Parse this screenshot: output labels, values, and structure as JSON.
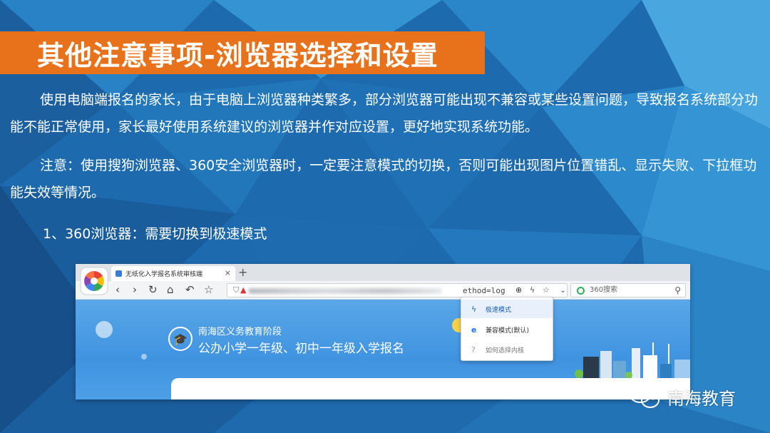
{
  "slide": {
    "title": "其他注意事项-浏览器选择和设置",
    "paragraph1": "使用电脑端报名的家长，由于电脑上浏览器种类繁多，部分浏览器可能出现不兼容或某些设置问题，导致报名系统部分功能不能正常使用，家长最好使用系统建议的浏览器并作对应设置，更好地实现系统功能。",
    "paragraph2": "注意：使用搜狗浏览器、360安全浏览器时，一定要注意模式的切换，否则可能出现图片位置错乱、显示失败、下拉框功能失效等情况。",
    "step1": "1、360浏览器：需要切换到极速模式",
    "watermark": "南海教育"
  },
  "browser": {
    "tab_title": "无纸化入学报名系统审核端",
    "tab_close": "×",
    "new_tab": "+",
    "nav": {
      "back": "‹",
      "forward": "›",
      "refresh": "↻",
      "home": "⌂",
      "undo": "↶",
      "star": "☆"
    },
    "url_suffix": "ethod=log",
    "search_placeholder": "360搜索",
    "dropdown": [
      {
        "label": "极速模式",
        "icon": "bolt-icon"
      },
      {
        "label": "兼容模式(默认)",
        "icon": "ie-icon"
      },
      {
        "label": "如何选择内核",
        "icon": "help-icon"
      }
    ]
  },
  "site": {
    "title1": "南海区义务教育阶段",
    "title2": "公办小学一年级、初中一年级入学报名"
  },
  "colors": {
    "title_bar": "#e8721c",
    "background": "#1f6fb2",
    "accent_blue": "#3f93e0"
  }
}
